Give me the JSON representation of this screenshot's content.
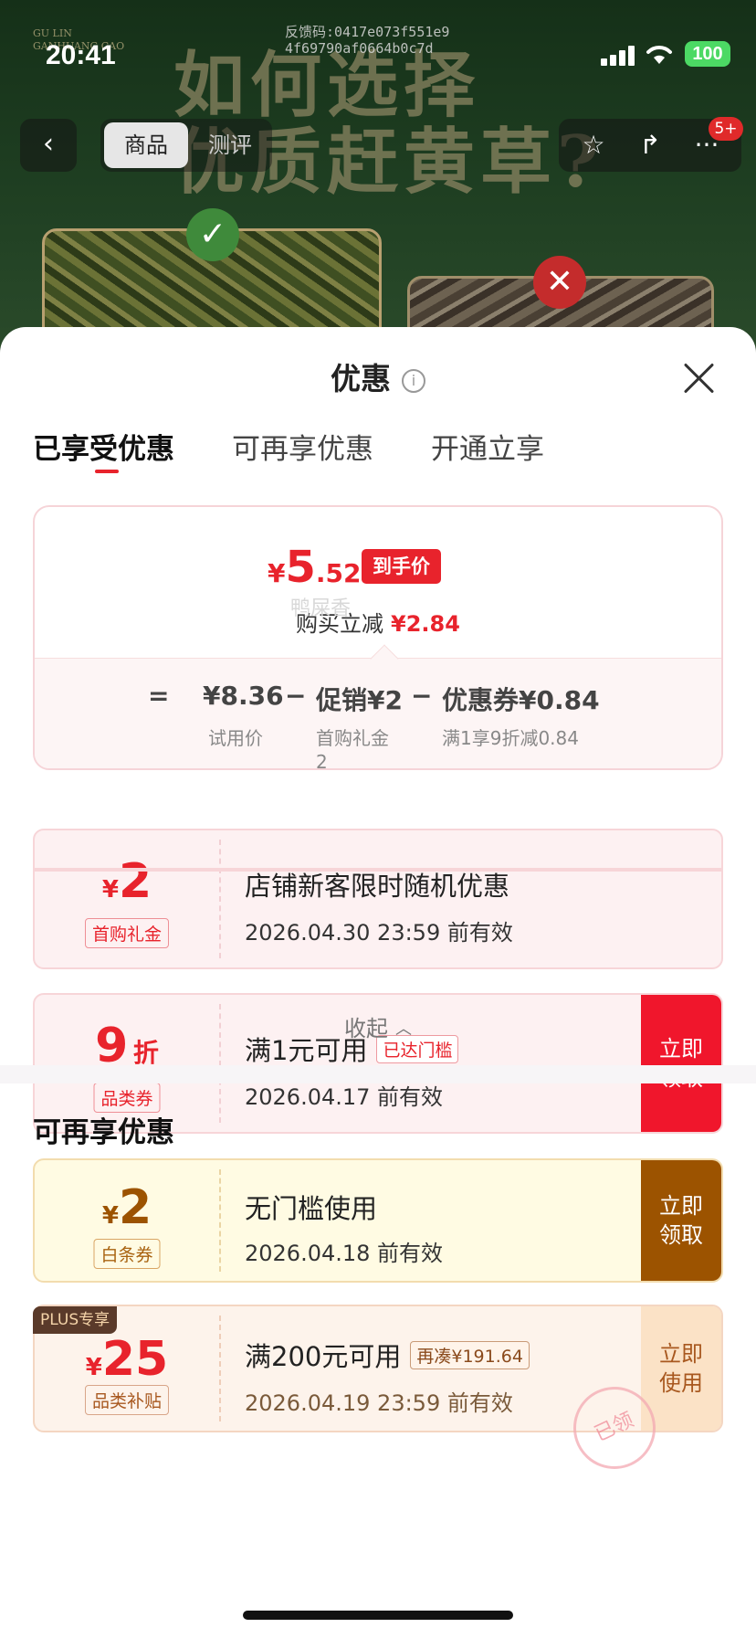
{
  "status_bar": {
    "time": "20:41",
    "battery": "100",
    "feedback_line1": "反馈码:0417e073f551e9",
    "feedback_line2": "4f69790af0664b0c7d"
  },
  "background": {
    "brand_line1": "GU LIN",
    "brand_line2": "GANHUANG CAO",
    "headline_line1": "如何选择",
    "headline_line2": "优质赶黄草?"
  },
  "nav": {
    "back_icon": "chevron-left-icon",
    "tab_product": "商品",
    "tab_review": "测评",
    "badge": "5+",
    "actions": [
      "star-icon",
      "share-icon",
      "more-icon"
    ]
  },
  "sheet": {
    "title": "优惠",
    "info_icon": "i",
    "tabs": [
      "已享受优惠",
      "可再享优惠",
      "开通立享"
    ]
  },
  "summary": {
    "currency": "¥",
    "final_int": "5",
    "final_dec": ".52",
    "final_tag": "到手价",
    "reduce_label": "购买立减",
    "reduce_amount": "¥2.84",
    "calc": {
      "equals": "=",
      "base": "¥8.36",
      "minus1": "−",
      "promo": "促销¥2",
      "minus2": "−",
      "coupon": "优惠券¥0.84",
      "base_sub": "试用价",
      "promo_sub1": "首购礼金",
      "promo_sub2": "2",
      "coupon_sub": "满1享9折减0.84"
    },
    "watermark": "鸭屎香"
  },
  "coupons_enjoyed": [
    {
      "currency": "¥",
      "amount": "2",
      "kind": "首购礼金",
      "title": "店铺新客限时随机优惠",
      "expiry": "2026.04.30 23:59 前有效"
    },
    {
      "amount": "9",
      "unit": "折",
      "kind": "品类券",
      "title": "满1元可用",
      "tag": "已达门槛",
      "expiry": "2026.04.17 前有效",
      "cta": "立即领取"
    }
  ],
  "collapse_label": "收起",
  "section_more": {
    "title": "可再享优惠",
    "coupons": [
      {
        "currency": "¥",
        "amount": "2",
        "kind": "白条券",
        "title": "无门槛使用",
        "expiry": "2026.04.18 前有效",
        "cta": "立即领取"
      },
      {
        "plus_tag": "PLUS专享",
        "currency": "¥",
        "amount": "25",
        "kind": "品类补贴",
        "title": "满200元可用",
        "tag": "再凑¥191.64",
        "expiry": "2026.04.19 23:59 前有效",
        "cta": "立即使用",
        "stamp": "已领"
      }
    ]
  },
  "colors": {
    "accent_red": "#e8232c",
    "gold_cta": "#9c5300",
    "plus_cta_bg": "#fbe2c6"
  }
}
